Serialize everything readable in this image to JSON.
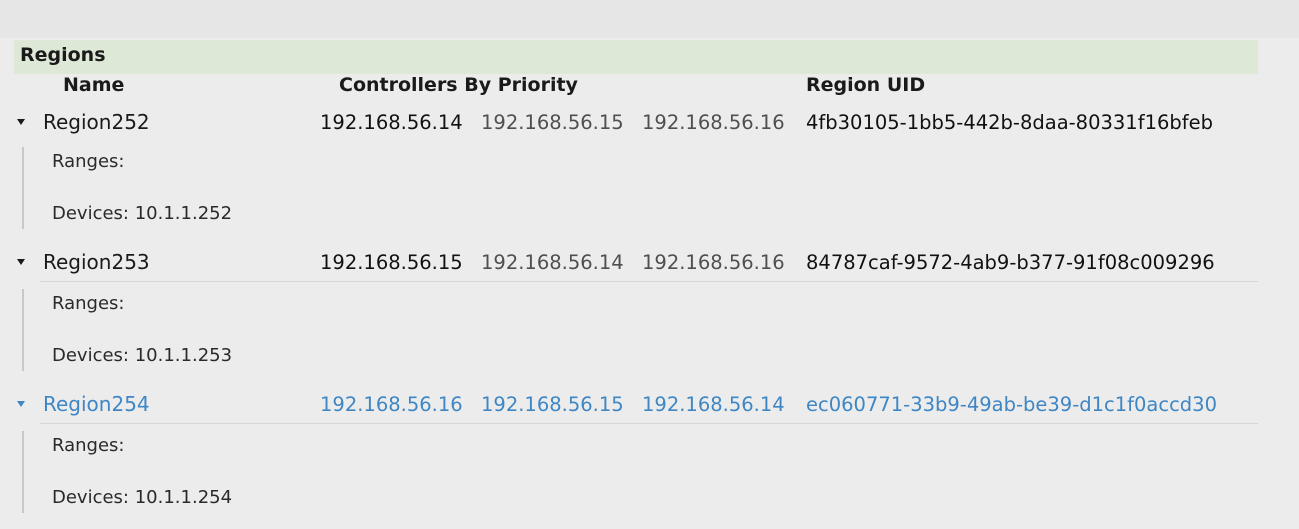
{
  "section": {
    "title": "Regions"
  },
  "columns": {
    "name": "Name",
    "controllers": "Controllers By Priority",
    "uid": "Region UID"
  },
  "icons": {
    "toggle": "triangle-down-icon"
  },
  "colors": {
    "header_band": "#dde8d6",
    "selected": "#3e86c4",
    "secondary_text": "#4f4f4f"
  },
  "regions": [
    {
      "name": "Region252",
      "controllers": [
        "192.168.56.14",
        "192.168.56.15",
        "192.168.56.16"
      ],
      "uid": "4fb30105-1bb5-442b-8daa-80331f16bfeb",
      "ranges_label": "Ranges:",
      "devices_label": "Devices: 10.1.1.252",
      "expanded": true,
      "selected": false
    },
    {
      "name": "Region253",
      "controllers": [
        "192.168.56.15",
        "192.168.56.14",
        "192.168.56.16"
      ],
      "uid": "84787caf-9572-4ab9-b377-91f08c009296",
      "ranges_label": "Ranges:",
      "devices_label": "Devices: 10.1.1.253",
      "expanded": true,
      "selected": false
    },
    {
      "name": "Region254",
      "controllers": [
        "192.168.56.16",
        "192.168.56.15",
        "192.168.56.14"
      ],
      "uid": "ec060771-33b9-49ab-be39-d1c1f0accd30",
      "ranges_label": "Ranges:",
      "devices_label": "Devices: 10.1.1.254",
      "expanded": true,
      "selected": true
    }
  ]
}
